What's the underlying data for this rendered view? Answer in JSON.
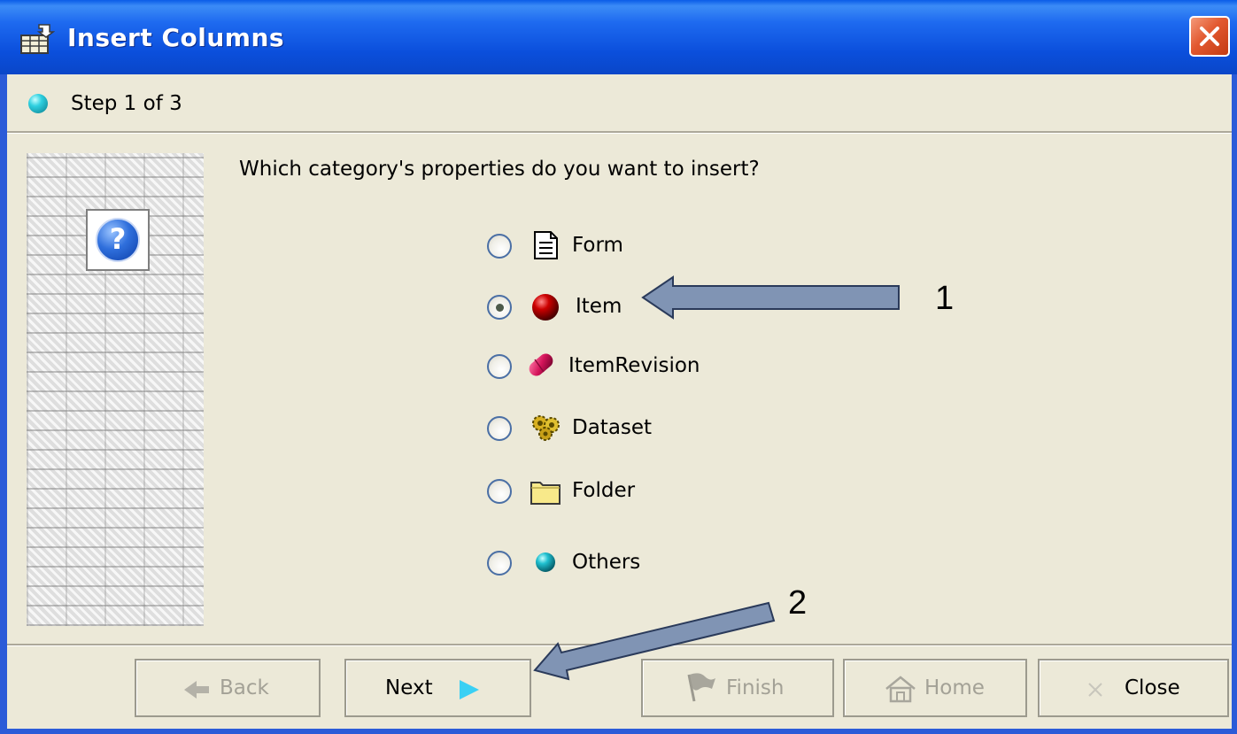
{
  "window": {
    "title": "Insert Columns",
    "title_icon": "insert-columns-icon",
    "close_icon": "close-icon",
    "accent_color": "#0a4fd8",
    "close_color": "#d9522a"
  },
  "step": {
    "text": "Step 1 of 3",
    "icon": "step-ball-icon"
  },
  "side": {
    "icon": "help-icon",
    "help_glyph": "?"
  },
  "question": "Which category's properties do you want to insert?",
  "options": [
    {
      "label": "Form",
      "icon": "form-document-icon",
      "checked": false
    },
    {
      "label": "Item",
      "icon": "item-red-ball-icon",
      "checked": true
    },
    {
      "label": "ItemRevision",
      "icon": "item-revision-pill-icon",
      "checked": false
    },
    {
      "label": "Dataset",
      "icon": "dataset-gears-icon",
      "checked": false
    },
    {
      "label": "Folder",
      "icon": "folder-icon",
      "checked": false
    },
    {
      "label": "Others",
      "icon": "others-ball-icon",
      "checked": false
    }
  ],
  "buttons": {
    "back": {
      "label": "Back",
      "icon": "back-arrow-icon",
      "enabled": false
    },
    "next": {
      "label": "Next",
      "icon": "next-arrow-icon",
      "enabled": true
    },
    "finish": {
      "label": "Finish",
      "icon": "finish-flag-icon",
      "enabled": false
    },
    "home": {
      "label": "Home",
      "icon": "home-icon",
      "enabled": false
    },
    "close": {
      "label": "Close",
      "icon": "close-x-icon",
      "enabled": true
    }
  },
  "annotations": [
    {
      "number": "1",
      "target": "Item option"
    },
    {
      "number": "2",
      "target": "Next button"
    }
  ]
}
